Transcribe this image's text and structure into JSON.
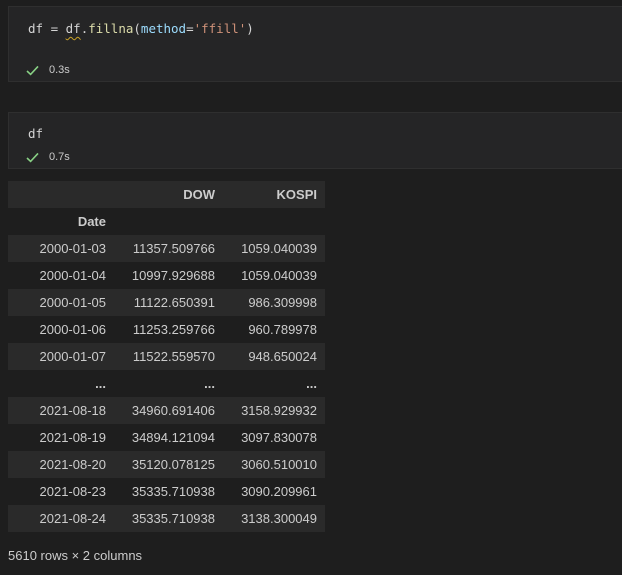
{
  "cells": [
    {
      "code": {
        "lhs": "df",
        "eq": " = ",
        "obj": "df",
        "dot": ".",
        "fn": "fillna",
        "open": "(",
        "param": "method",
        "assign": "=",
        "str": "'ffill'",
        "close": ")"
      },
      "status_time": "0.3s"
    },
    {
      "code": {
        "text": "df"
      },
      "status_time": "0.7s"
    }
  ],
  "dataframe": {
    "columns": [
      "DOW",
      "KOSPI"
    ],
    "index_name": "Date",
    "rows": [
      {
        "date": "2000-01-03",
        "dow": "11357.509766",
        "kospi": "1059.040039"
      },
      {
        "date": "2000-01-04",
        "dow": "10997.929688",
        "kospi": "1059.040039"
      },
      {
        "date": "2000-01-05",
        "dow": "11122.650391",
        "kospi": "986.309998"
      },
      {
        "date": "2000-01-06",
        "dow": "11253.259766",
        "kospi": "960.789978"
      },
      {
        "date": "2000-01-07",
        "dow": "11522.559570",
        "kospi": "948.650024"
      },
      {
        "date": "...",
        "dow": "...",
        "kospi": "..."
      },
      {
        "date": "2021-08-18",
        "dow": "34960.691406",
        "kospi": "3158.929932"
      },
      {
        "date": "2021-08-19",
        "dow": "34894.121094",
        "kospi": "3097.830078"
      },
      {
        "date": "2021-08-20",
        "dow": "35120.078125",
        "kospi": "3060.510010"
      },
      {
        "date": "2021-08-23",
        "dow": "35335.710938",
        "kospi": "3090.209961"
      },
      {
        "date": "2021-08-24",
        "dow": "35335.710938",
        "kospi": "3138.300049"
      }
    ],
    "shape_text": "5610 rows × 2 columns"
  },
  "icons": {
    "status": "check-icon"
  },
  "colors": {
    "success": "#89d185",
    "background": "#1e1e1e",
    "cell_background": "#252526"
  }
}
